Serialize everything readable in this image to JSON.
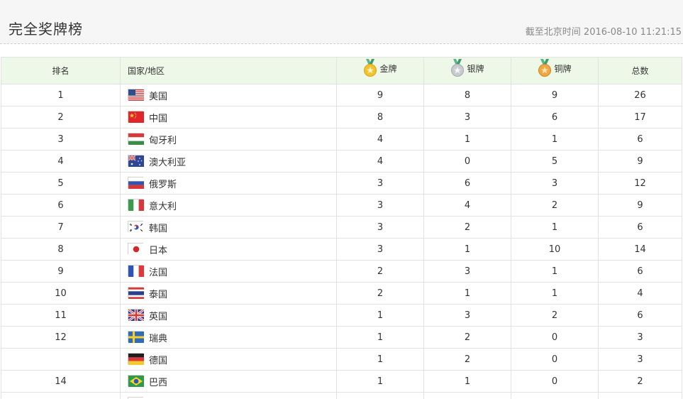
{
  "header": {
    "title": "完全奖牌榜",
    "updated": "截至北京时间 2016-08-10 11:21:15"
  },
  "table": {
    "columns": {
      "rank": "排名",
      "country": "国家/地区",
      "gold": "金牌",
      "silver": "银牌",
      "bronze": "铜牌",
      "total": "总数"
    },
    "medal_colors": {
      "gold": "#f2c230",
      "silver": "#c8ccd0",
      "bronze": "#f0a844",
      "ribbon": "#5bb58a"
    },
    "rows": [
      {
        "rank": "1",
        "country": "美国",
        "flag": "us-flag-icon",
        "gold": "9",
        "silver": "8",
        "bronze": "9",
        "total": "26"
      },
      {
        "rank": "2",
        "country": "中国",
        "flag": "cn-flag-icon",
        "gold": "8",
        "silver": "3",
        "bronze": "6",
        "total": "17"
      },
      {
        "rank": "3",
        "country": "匈牙利",
        "flag": "hu-flag-icon",
        "gold": "4",
        "silver": "1",
        "bronze": "1",
        "total": "6"
      },
      {
        "rank": "4",
        "country": "澳大利亚",
        "flag": "au-flag-icon",
        "gold": "4",
        "silver": "0",
        "bronze": "5",
        "total": "9"
      },
      {
        "rank": "5",
        "country": "俄罗斯",
        "flag": "ru-flag-icon",
        "gold": "3",
        "silver": "6",
        "bronze": "3",
        "total": "12"
      },
      {
        "rank": "6",
        "country": "意大利",
        "flag": "it-flag-icon",
        "gold": "3",
        "silver": "4",
        "bronze": "2",
        "total": "9"
      },
      {
        "rank": "7",
        "country": "韩国",
        "flag": "kr-flag-icon",
        "gold": "3",
        "silver": "2",
        "bronze": "1",
        "total": "6"
      },
      {
        "rank": "8",
        "country": "日本",
        "flag": "jp-flag-icon",
        "gold": "3",
        "silver": "1",
        "bronze": "10",
        "total": "14"
      },
      {
        "rank": "9",
        "country": "法国",
        "flag": "fr-flag-icon",
        "gold": "2",
        "silver": "3",
        "bronze": "1",
        "total": "6"
      },
      {
        "rank": "10",
        "country": "泰国",
        "flag": "th-flag-icon",
        "gold": "2",
        "silver": "1",
        "bronze": "1",
        "total": "4"
      },
      {
        "rank": "11",
        "country": "英国",
        "flag": "gb-flag-icon",
        "gold": "1",
        "silver": "3",
        "bronze": "2",
        "total": "6"
      },
      {
        "rank": "12",
        "country": "瑞典",
        "flag": "se-flag-icon",
        "gold": "1",
        "silver": "2",
        "bronze": "0",
        "total": "3"
      },
      {
        "rank": "",
        "country": "德国",
        "flag": "de-flag-icon",
        "gold": "1",
        "silver": "2",
        "bronze": "0",
        "total": "3"
      },
      {
        "rank": "14",
        "country": "巴西",
        "flag": "br-flag-icon",
        "gold": "1",
        "silver": "1",
        "bronze": "0",
        "total": "2"
      },
      {
        "rank": "",
        "country": "",
        "flag": "kr-flag-icon",
        "gold": "",
        "silver": "",
        "bronze": "",
        "total": ""
      }
    ]
  }
}
